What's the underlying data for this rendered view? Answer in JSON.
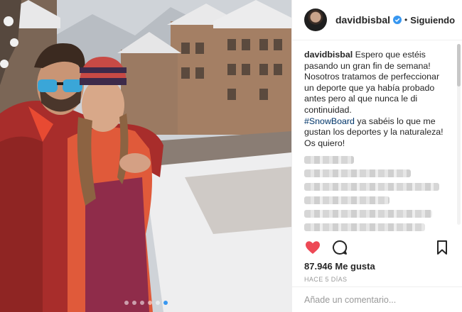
{
  "post": {
    "photo_count": 6,
    "active_photo_index": 5
  },
  "header": {
    "username": "davidbisbal",
    "separator": "•",
    "follow_status": "Siguiendo"
  },
  "caption": {
    "username": "davidbisbal",
    "text_1": " Espero que estéis pasando un gran fin de semana!",
    "text_2": "Nosotros tratamos de perfeccionar un deporte que ya había probado antes pero al que nunca le di continuidad.",
    "hashtag": "#SnowBoard",
    "text_3": " ya sabéis lo que me gustan los deportes y la naturaleza! Os quiero!"
  },
  "likes": "87.946 Me gusta",
  "time_ago": "HACE 5 DÍAS",
  "comment_box": {
    "placeholder": "Añade un comentario..."
  },
  "icons": {
    "like": "heart-icon-filled",
    "comment": "speech-bubble-icon",
    "save": "bookmark-icon",
    "verified": "verified-badge-icon"
  },
  "colors": {
    "like_red": "#ed4956",
    "verified_blue": "#3897f0",
    "hashtag_blue": "#003569",
    "muted_gray": "#999999"
  }
}
